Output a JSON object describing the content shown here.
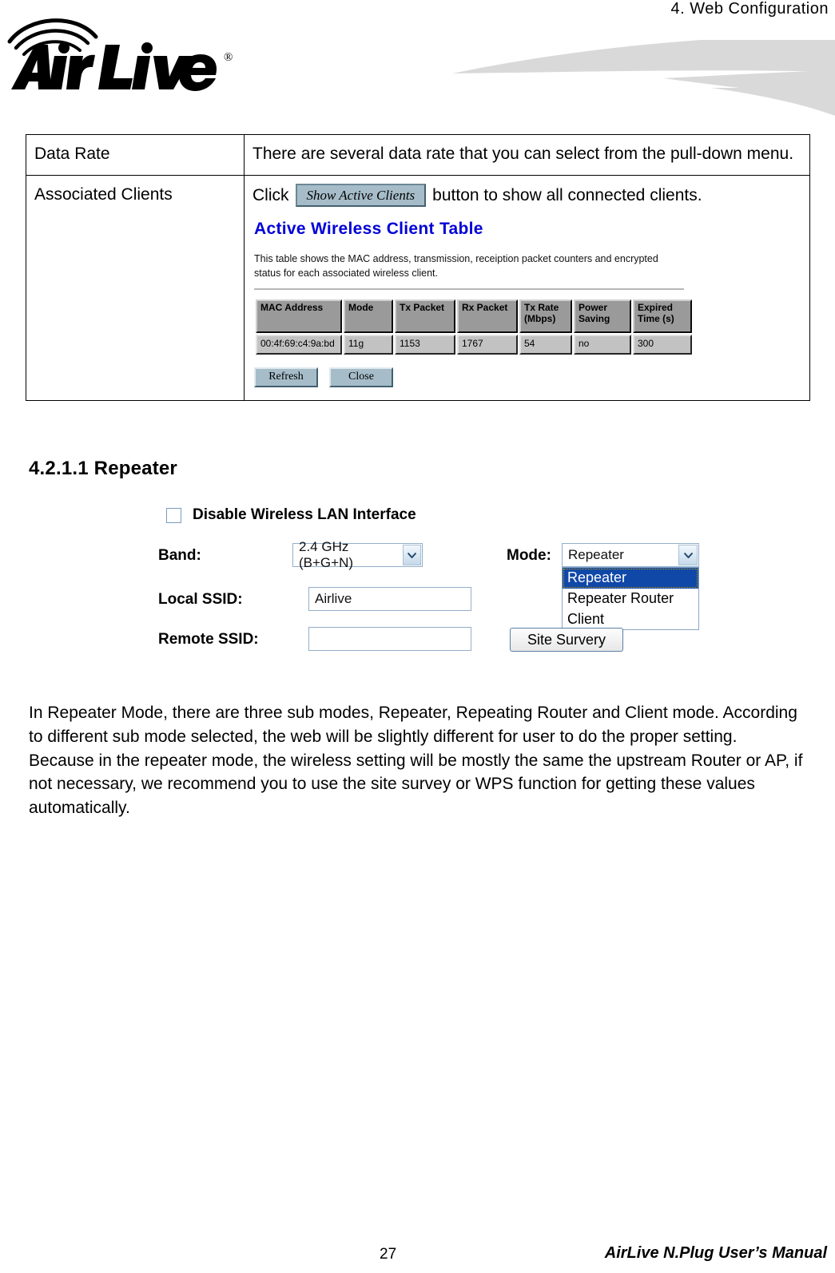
{
  "header": {
    "chapter_title": "4.  Web  Configuration",
    "brand": "Air Live",
    "brand_mark": "®"
  },
  "description_table": {
    "rows": [
      {
        "label": "Data Rate",
        "text": "There are several data rate that you can select from the pull-down menu."
      },
      {
        "label": "Associated Clients",
        "text_before": "Click",
        "button_label": "Show Active Clients",
        "text_after": "button to show all connected clients."
      }
    ]
  },
  "client_table_screenshot": {
    "title": "Active Wireless Client Table",
    "description": "This table shows the MAC address, transmission, receiption packet counters and encrypted status for each associated wireless client.",
    "columns": [
      "MAC Address",
      "Mode",
      "Tx Packet",
      "Rx Packet",
      "Tx Rate (Mbps)",
      "Power Saving",
      "Expired Time (s)"
    ],
    "rows": [
      {
        "mac_address": "00:4f:69:c4:9a:bd",
        "mode": "11g",
        "tx_packet": "1153",
        "rx_packet": "1767",
        "tx_rate": "54",
        "power_saving": "no",
        "expired_time": "300"
      }
    ],
    "buttons": {
      "refresh": "Refresh",
      "close": "Close"
    },
    "colors": {
      "title": "#0000d8",
      "header_cell_bg": "#9a9a9a",
      "data_cell_bg": "#c2c2c2",
      "button_bg": "#a6bdc9"
    }
  },
  "section": {
    "heading": "4.2.1.1 Repeater"
  },
  "repeater_screenshot": {
    "disable_checkbox_label": "Disable Wireless LAN Interface",
    "disable_checkbox_checked": false,
    "band_label": "Band:",
    "band_value": "2.4 GHz (B+G+N)",
    "mode_label": "Mode:",
    "mode_value": "Repeater",
    "mode_options": [
      "Repeater",
      "Repeater Router",
      "Client"
    ],
    "mode_selected_index": 0,
    "local_ssid_label": "Local SSID:",
    "local_ssid_value": "Airlive",
    "remote_ssid_label": "Remote SSID:",
    "remote_ssid_value": "",
    "site_survey_button": "Site Survery",
    "colors": {
      "selected_option_bg": "#1048a8",
      "field_border": "#93aec9"
    }
  },
  "body_paragraph": {
    "text": "In Repeater Mode, there are three sub modes, Repeater, Repeating Router and Client mode. According to different sub mode selected, the web will be slightly different for user to do the proper setting. Because in the repeater mode, the wireless setting will be mostly the same the upstream Router or AP, if not necessary, we recommend you to use the site survey or WPS function for getting these values automatically."
  },
  "footer": {
    "page_number": "27",
    "manual_title": "AirLive N.Plug User’s Manual"
  }
}
